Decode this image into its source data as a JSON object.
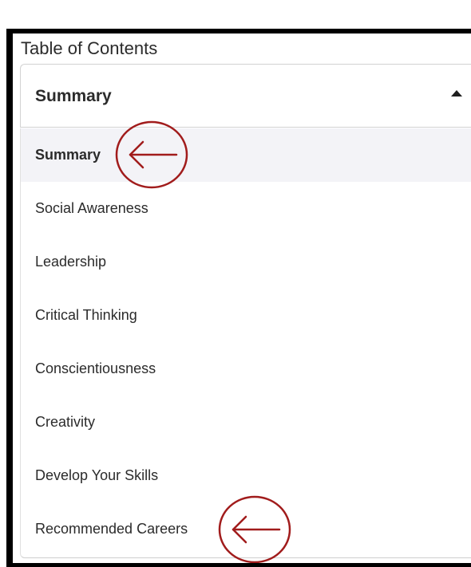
{
  "toc": {
    "label": "Table of Contents",
    "selected_value": "Summary",
    "caret_icon": "caret-up-icon",
    "items": [
      {
        "label": "Summary",
        "selected": true
      },
      {
        "label": "Social Awareness",
        "selected": false
      },
      {
        "label": "Leadership",
        "selected": false
      },
      {
        "label": "Critical Thinking",
        "selected": false
      },
      {
        "label": "Conscientiousness",
        "selected": false
      },
      {
        "label": "Creativity",
        "selected": false
      },
      {
        "label": "Develop Your Skills",
        "selected": false
      },
      {
        "label": "Recommended Careers",
        "selected": false
      }
    ]
  },
  "annotations": {
    "color": "#a11c1c",
    "icon": "circled-left-arrow-icon"
  },
  "colors": {
    "frame": "#000000",
    "selected_row": "#f3f3f7",
    "text": "#2b2b2b"
  }
}
